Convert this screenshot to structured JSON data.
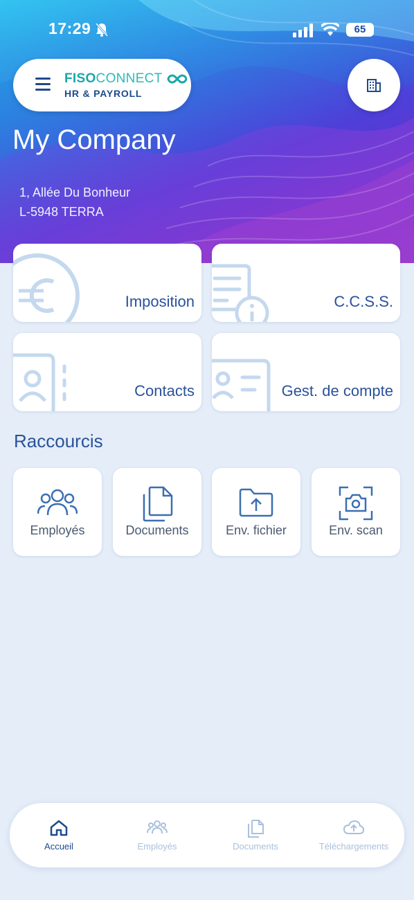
{
  "status_bar": {
    "time": "17:29",
    "battery": "65"
  },
  "header": {
    "logo_bold": "FISO",
    "logo_light": "CONNECT",
    "logo_subtitle": "HR & PAYROLL",
    "company_name": "My Company",
    "address_line1": "1, Allée Du Bonheur",
    "address_line2": "L-5948 TERRA"
  },
  "cards": [
    {
      "label": "Imposition",
      "icon": "euro-icon"
    },
    {
      "label": "C.C.S.S.",
      "icon": "document-info-icon"
    },
    {
      "label": "Contacts",
      "icon": "contact-book-icon"
    },
    {
      "label": "Gest. de compte",
      "icon": "id-card-icon"
    }
  ],
  "shortcuts": {
    "title": "Raccourcis",
    "items": [
      {
        "label": "Employés",
        "icon": "users-icon"
      },
      {
        "label": "Documents",
        "icon": "documents-icon"
      },
      {
        "label": "Env. fichier",
        "icon": "folder-upload-icon"
      },
      {
        "label": "Env. scan",
        "icon": "camera-scan-icon"
      }
    ]
  },
  "tabbar": {
    "items": [
      {
        "label": "Accueil",
        "icon": "home-icon",
        "active": true
      },
      {
        "label": "Employés",
        "icon": "users-icon",
        "active": false
      },
      {
        "label": "Documents",
        "icon": "documents-icon",
        "active": false
      },
      {
        "label": "Téléchargements",
        "icon": "cloud-upload-icon",
        "active": false
      }
    ]
  },
  "colors": {
    "primary": "#2a5299",
    "dark_navy": "#1e4a8c",
    "teal": "#1aa7a8",
    "background": "#e4edf8",
    "inactive_tab": "#a9c0dc",
    "card_icon_faint": "#c4d8ee"
  }
}
